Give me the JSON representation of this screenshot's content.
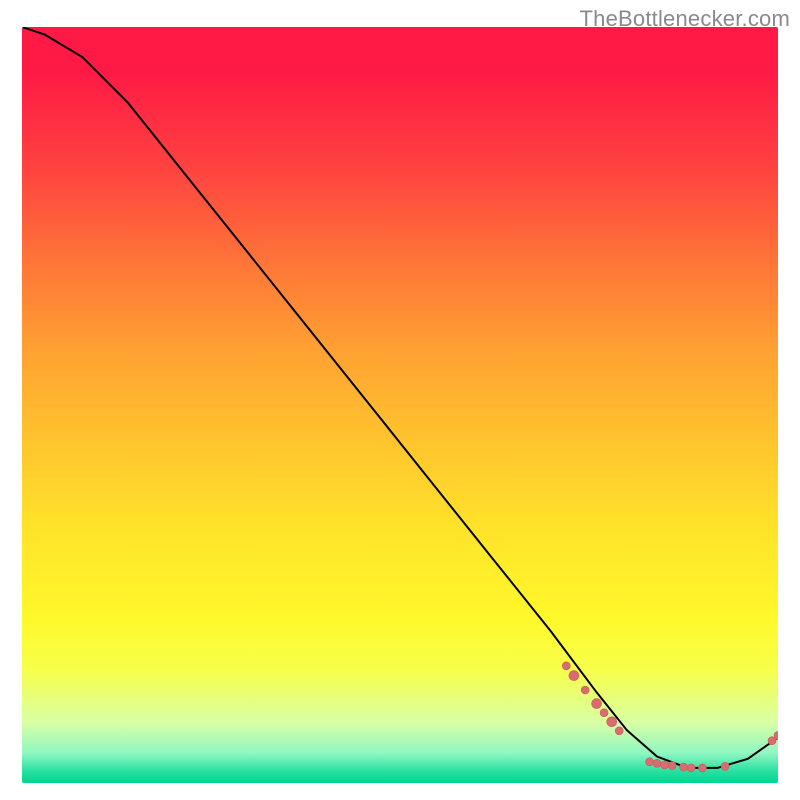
{
  "attribution": "TheBottlenecker.com",
  "colors": {
    "curve_stroke": "#000000",
    "marker_fill": "#d86c6e",
    "marker_stroke": "#c85a5c"
  },
  "chart_data": {
    "type": "line",
    "title": "",
    "xlabel": "",
    "ylabel": "",
    "xlim": [
      0,
      100
    ],
    "ylim": [
      0,
      100
    ],
    "series": [
      {
        "name": "curve",
        "x": [
          0,
          3,
          8,
          14,
          22,
          30,
          38,
          46,
          54,
          62,
          70,
          76,
          80,
          84,
          88,
          92,
          96,
          100
        ],
        "y": [
          100,
          99,
          96,
          90,
          80,
          70,
          60,
          50,
          40,
          30,
          20,
          12,
          7,
          3.5,
          2,
          2,
          3.2,
          6
        ]
      }
    ],
    "markers": [
      {
        "x": 72,
        "y": 15.5,
        "r": 4
      },
      {
        "x": 73,
        "y": 14.2,
        "r": 5
      },
      {
        "x": 74.5,
        "y": 12.3,
        "r": 4
      },
      {
        "x": 76,
        "y": 10.5,
        "r": 5
      },
      {
        "x": 77,
        "y": 9.3,
        "r": 4
      },
      {
        "x": 78,
        "y": 8.1,
        "r": 5
      },
      {
        "x": 79,
        "y": 6.9,
        "r": 4
      },
      {
        "x": 83,
        "y": 2.8,
        "r": 4
      },
      {
        "x": 84,
        "y": 2.6,
        "r": 4
      },
      {
        "x": 85,
        "y": 2.4,
        "r": 4
      },
      {
        "x": 86,
        "y": 2.3,
        "r": 4
      },
      {
        "x": 87.5,
        "y": 2.1,
        "r": 4
      },
      {
        "x": 88.5,
        "y": 2.0,
        "r": 4
      },
      {
        "x": 90,
        "y": 2.0,
        "r": 4
      },
      {
        "x": 93,
        "y": 2.2,
        "r": 4
      },
      {
        "x": 99.2,
        "y": 5.6,
        "r": 4
      },
      {
        "x": 100,
        "y": 6.3,
        "r": 4
      }
    ]
  }
}
